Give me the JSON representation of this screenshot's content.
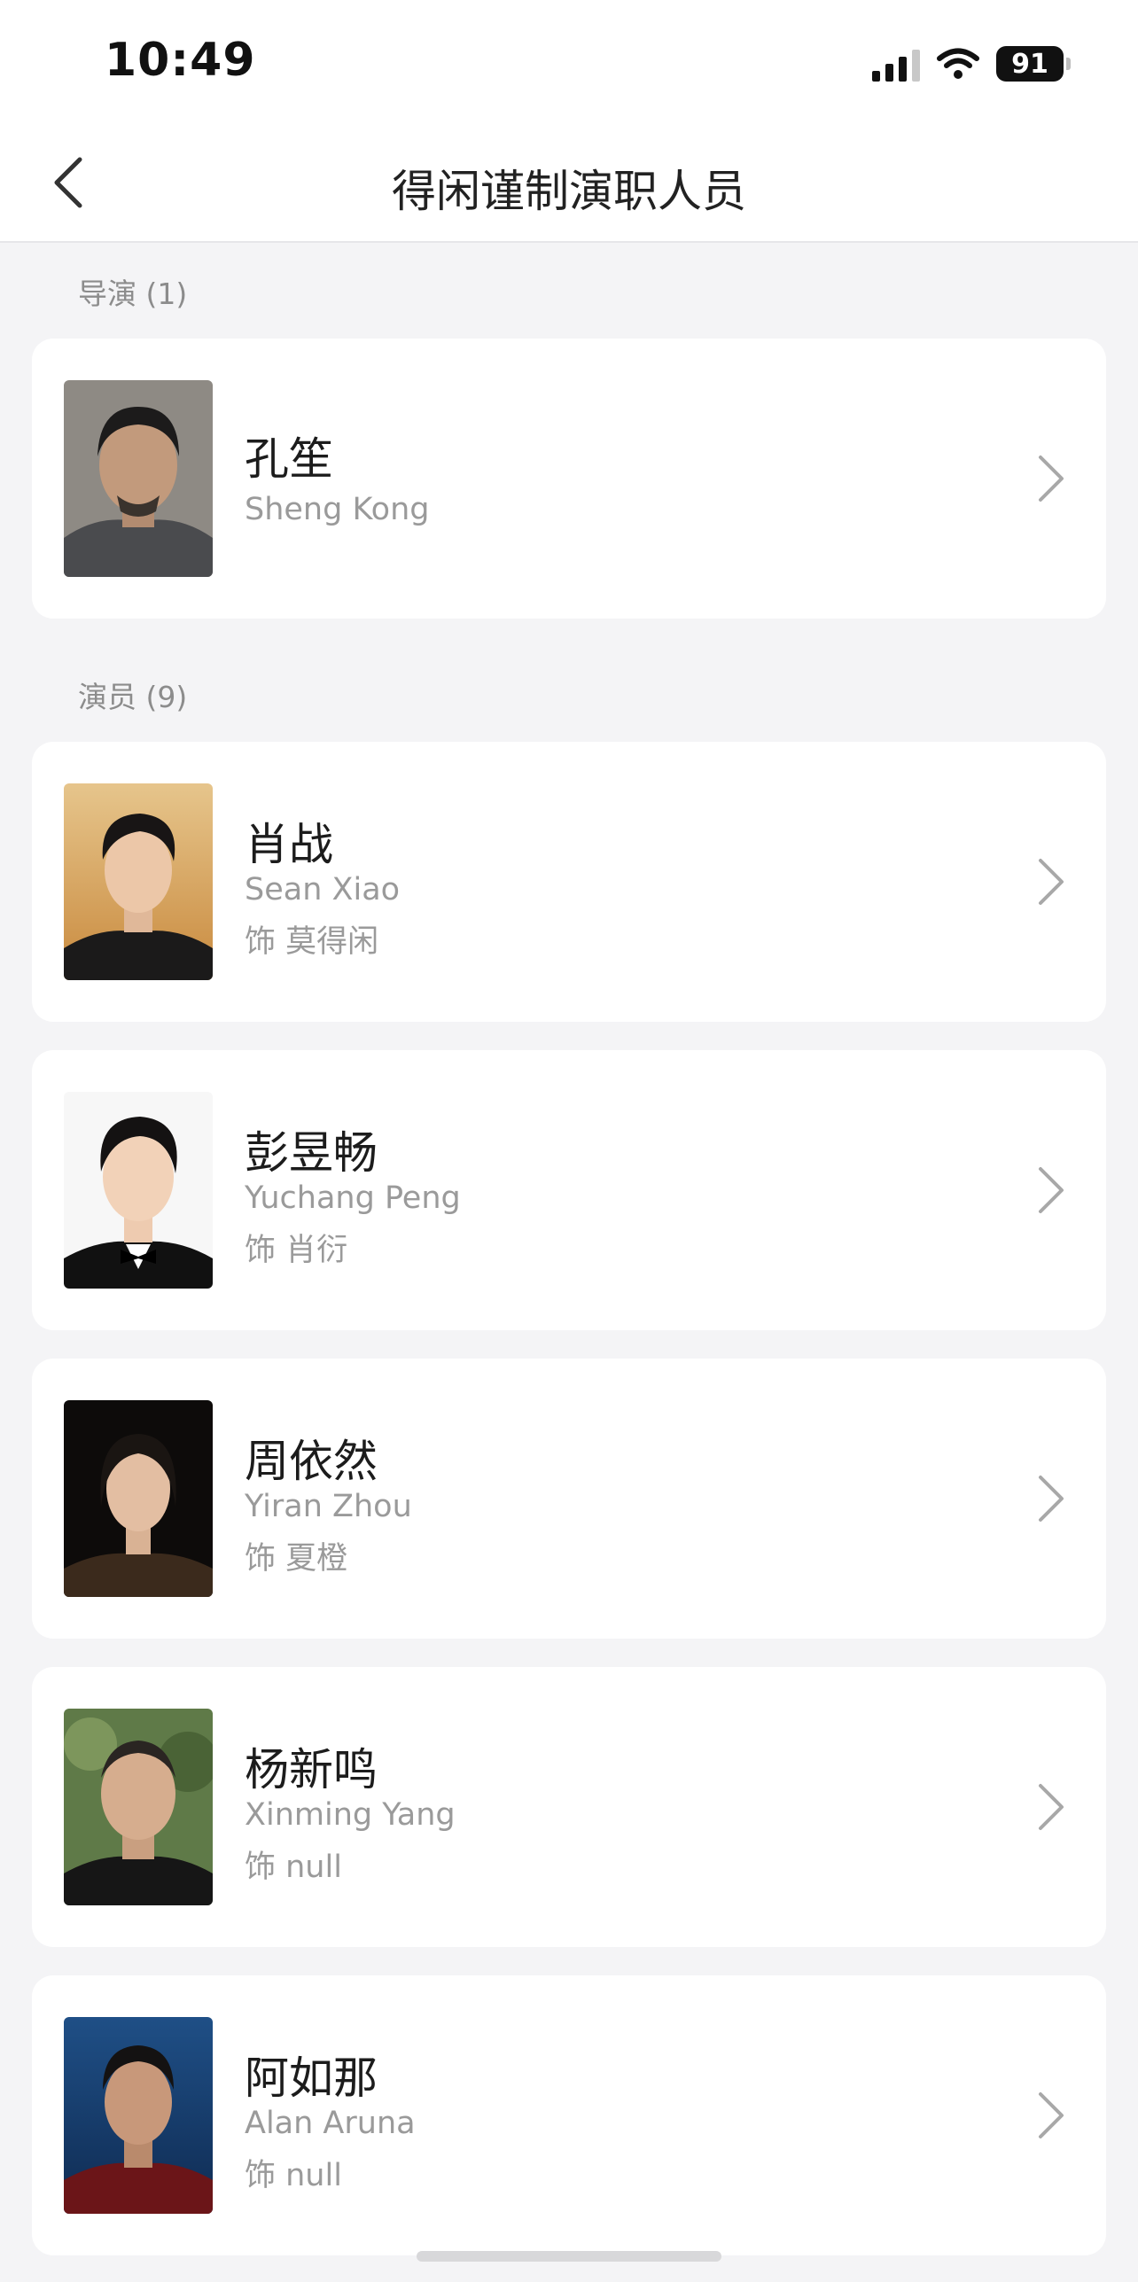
{
  "status_bar": {
    "time": "10:49",
    "battery": "91"
  },
  "nav": {
    "title": "得闲谨制演职人员"
  },
  "directors": {
    "label": "导演 (1)",
    "items": [
      {
        "name": "孔笙",
        "english": "Sheng Kong"
      }
    ]
  },
  "actors": {
    "label": "演员 (9)",
    "items": [
      {
        "name": "肖战",
        "english": "Sean Xiao",
        "role": "饰 莫得闲"
      },
      {
        "name": "彭昱畅",
        "english": "Yuchang Peng",
        "role": "饰 肖衍"
      },
      {
        "name": "周依然",
        "english": "Yiran Zhou",
        "role": "饰 夏橙"
      },
      {
        "name": "杨新鸣",
        "english": "Xinming Yang",
        "role": "饰 null"
      },
      {
        "name": "阿如那",
        "english": "Alan Aruna",
        "role": "饰 null"
      }
    ]
  },
  "colors": {
    "background": "#f4f4f6",
    "card": "#ffffff",
    "secondary_text": "#9a9a9a",
    "section_label": "#8c8c8c"
  }
}
